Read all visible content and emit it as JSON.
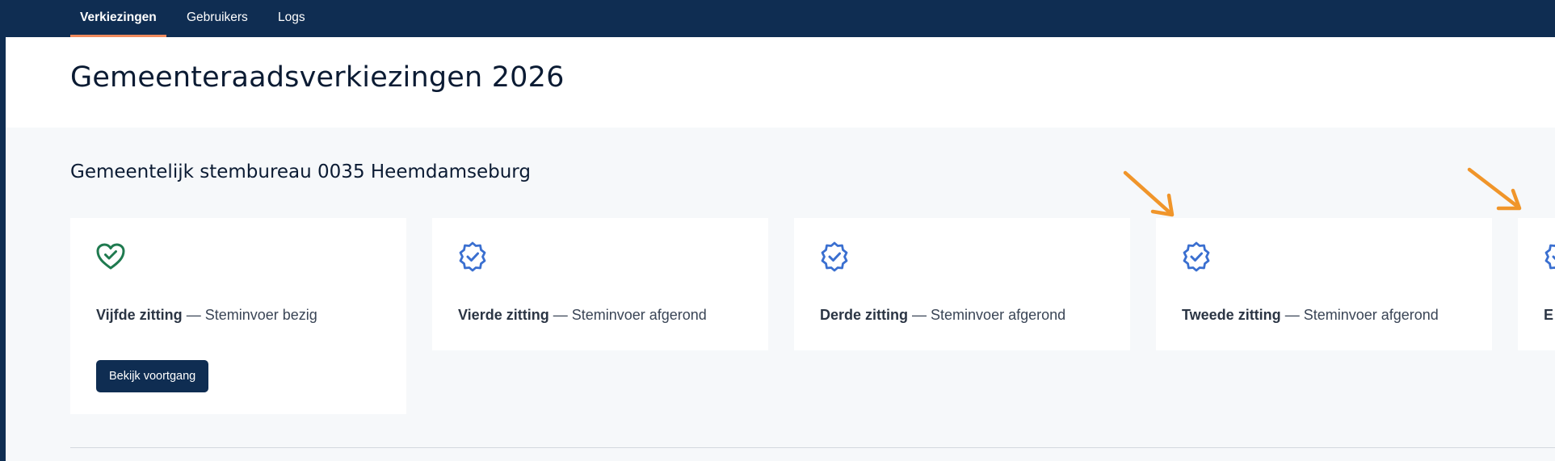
{
  "nav": {
    "tabs": [
      {
        "label": "Verkiezingen"
      },
      {
        "label": "Gebruikers"
      },
      {
        "label": "Logs"
      }
    ]
  },
  "page": {
    "title": "Gemeenteraadsverkiezingen 2026"
  },
  "section": {
    "title": "Gemeentelijk stembureau 0035 Heemdamseburg"
  },
  "cards": [
    {
      "name": "Vijfde zitting",
      "status": "— Steminvoer bezig",
      "icon": "heart-check-icon",
      "button": "Bekijk voortgang"
    },
    {
      "name": "Vierde zitting",
      "status": "— Steminvoer afgerond",
      "icon": "badge-check-icon"
    },
    {
      "name": "Derde zitting",
      "status": "— Steminvoer afgerond",
      "icon": "badge-check-icon"
    },
    {
      "name": "Tweede zitting",
      "status": "— Steminvoer afgerond",
      "icon": "badge-check-icon"
    },
    {
      "name": "E",
      "status": "",
      "icon": "badge-check-icon"
    }
  ],
  "colors": {
    "navy": "#0f2d52",
    "accent": "#f08a5d",
    "success_green": "#1f7a4f",
    "badge_blue": "#3a6fd0",
    "annotation_orange": "#f0952a"
  }
}
